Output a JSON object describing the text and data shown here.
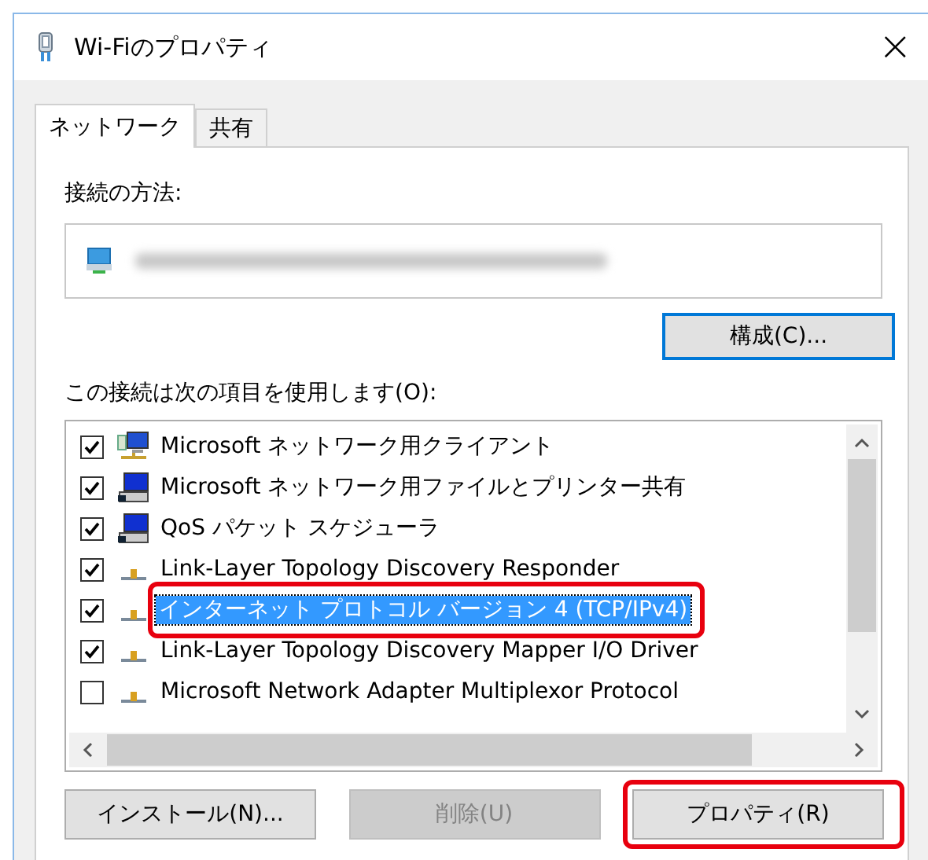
{
  "window": {
    "title": "Wi-Fiのプロパティ",
    "close": "×"
  },
  "tabs": [
    {
      "label": "ネットワーク",
      "selected": true
    },
    {
      "label": "共有",
      "selected": false
    }
  ],
  "connection": {
    "label": "接続の方法:",
    "adapter": {
      "kind": "redacted"
    },
    "configure_button": "構成(C)..."
  },
  "items_label": "この接続は次の項目を使用します(O):",
  "items": [
    {
      "label": "Microsoft ネットワーク用クライアント",
      "checked": true,
      "selected": false,
      "kind": "client",
      "highlighted": false
    },
    {
      "label": "Microsoft ネットワーク用ファイルとプリンター共有",
      "checked": true,
      "selected": false,
      "kind": "service",
      "highlighted": false
    },
    {
      "label": "QoS パケット スケジューラ",
      "checked": true,
      "selected": false,
      "kind": "service",
      "highlighted": false
    },
    {
      "label": "Link-Layer Topology Discovery Responder",
      "checked": true,
      "selected": false,
      "kind": "protocol",
      "highlighted": false
    },
    {
      "label": "インターネット プロトコル バージョン 4 (TCP/IPv4)",
      "checked": true,
      "selected": true,
      "kind": "protocol",
      "highlighted": true
    },
    {
      "label": "Link-Layer Topology Discovery Mapper I/O Driver",
      "checked": true,
      "selected": false,
      "kind": "protocol",
      "highlighted": false
    },
    {
      "label": "Microsoft Network Adapter Multiplexor Protocol",
      "checked": false,
      "selected": false,
      "kind": "protocol",
      "highlighted": false
    }
  ],
  "buttons": [
    {
      "label": "インストール(N)...",
      "disabled": false,
      "highlighted": false
    },
    {
      "label": "削除(U)",
      "disabled": true,
      "highlighted": false
    },
    {
      "label": "プロパティ(R)",
      "disabled": false,
      "highlighted": true
    }
  ]
}
